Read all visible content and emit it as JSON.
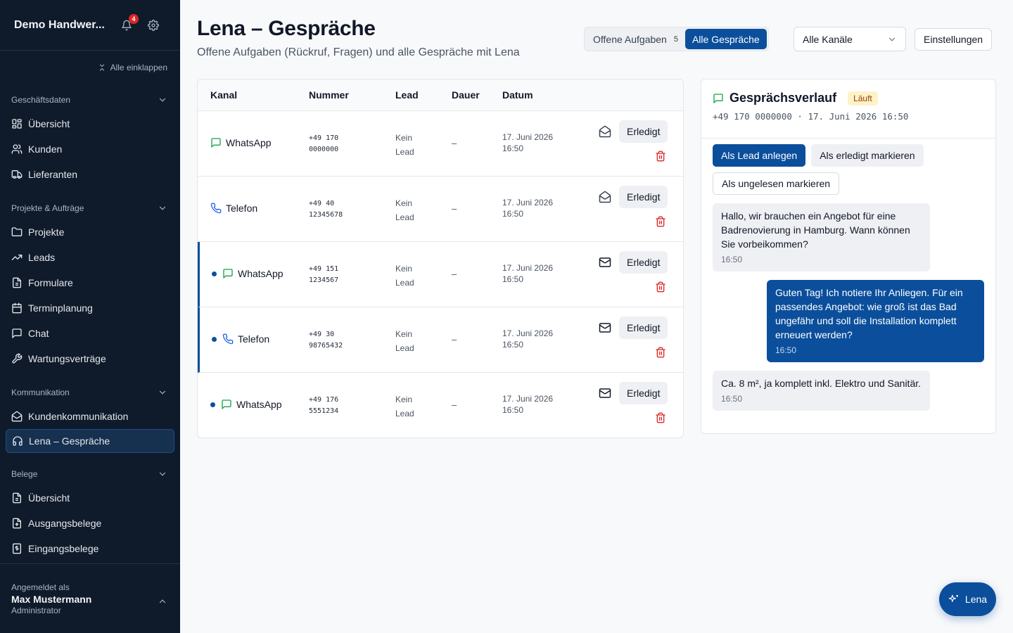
{
  "sidebar": {
    "title": "Demo Handwer...",
    "notification_count": "4",
    "collapse_all": "Alle einklappen",
    "sections": [
      {
        "title": "Geschäftsdaten",
        "items": [
          "Übersicht",
          "Kunden",
          "Lieferanten"
        ]
      },
      {
        "title": "Projekte & Aufträge",
        "items": [
          "Projekte",
          "Leads",
          "Formulare",
          "Terminplanung",
          "Chat",
          "Wartungsverträge"
        ]
      },
      {
        "title": "Kommunikation",
        "items": [
          "Kundenkommunikation",
          "Lena – Gespräche"
        ]
      },
      {
        "title": "Belege",
        "items": [
          "Übersicht",
          "Ausgangsbelege",
          "Eingangsbelege"
        ]
      }
    ],
    "active_item": "Lena – Gespräche",
    "footer": {
      "label": "Angemeldet als",
      "name": "Max Mustermann",
      "role": "Administrator"
    }
  },
  "header": {
    "title": "Lena – Gespräche",
    "subtitle": "Offene Aufgaben (Rückruf, Fragen) und alle Gespräche mit Lena",
    "toggle": {
      "open_label": "Offene Aufgaben",
      "open_count": "5",
      "all_label": "Alle Gespräche"
    },
    "channel_select": "Alle Kanäle",
    "settings": "Einstellungen"
  },
  "table": {
    "columns": [
      "Kanal",
      "Nummer",
      "Lead",
      "Dauer",
      "Datum"
    ],
    "rows": [
      {
        "channel": "WhatsApp",
        "channel_icon": "whatsapp-icon",
        "number_line1": "+49 170",
        "number_line2": "0000000",
        "lead_line1": "Kein",
        "lead_line2": "Lead",
        "duration": "–",
        "date_line1": "17. Juni 2026",
        "date_line2": "16:50",
        "done": "Erledigt",
        "unread": false,
        "mail_icon": "mail-open-icon"
      },
      {
        "channel": "Telefon",
        "channel_icon": "phone-icon",
        "number_line1": "+49 40",
        "number_line2": "12345678",
        "lead_line1": "Kein",
        "lead_line2": "Lead",
        "duration": "–",
        "date_line1": "17. Juni 2026",
        "date_line2": "16:50",
        "done": "Erledigt",
        "unread": false,
        "mail_icon": "mail-open-icon"
      },
      {
        "channel": "WhatsApp",
        "channel_icon": "whatsapp-icon",
        "number_line1": "+49 151",
        "number_line2": "1234567",
        "lead_line1": "Kein",
        "lead_line2": "Lead",
        "duration": "–",
        "date_line1": "17. Juni 2026",
        "date_line2": "16:50",
        "done": "Erledigt",
        "unread": true,
        "mail_icon": "mail-icon"
      },
      {
        "channel": "Telefon",
        "channel_icon": "phone-icon",
        "number_line1": "+49 30",
        "number_line2": "98765432",
        "lead_line1": "Kein",
        "lead_line2": "Lead",
        "duration": "–",
        "date_line1": "17. Juni 2026",
        "date_line2": "16:50",
        "done": "Erledigt",
        "unread": true,
        "mail_icon": "mail-icon"
      },
      {
        "channel": "WhatsApp",
        "channel_icon": "whatsapp-icon",
        "number_line1": "+49 176",
        "number_line2": "5551234",
        "lead_line1": "Kein",
        "lead_line2": "Lead",
        "duration": "–",
        "date_line1": "17. Juni 2026",
        "date_line2": "16:50",
        "done": "Erledigt",
        "unread": false,
        "dot": true,
        "mail_icon": "mail-icon"
      }
    ]
  },
  "conversation": {
    "title": "Gesprächsverlauf",
    "status": "Läuft",
    "meta": "+49 170 0000000 · 17. Juni 2026 16:50",
    "actions": {
      "create_lead": "Als Lead anlegen",
      "mark_done": "Als erledigt markieren",
      "mark_unread": "Als ungelesen markieren"
    },
    "messages": [
      {
        "direction": "in",
        "text": "Hallo, wir brauchen ein Angebot für eine Badrenovierung in Hamburg. Wann können Sie vorbeikommen?",
        "time": "16:50"
      },
      {
        "direction": "out",
        "text": "Guten Tag! Ich notiere Ihr Anliegen. Für ein passendes Angebot: wie groß ist das Bad ungefähr und soll die Installation komplett erneuert werden?",
        "time": "16:50"
      },
      {
        "direction": "in",
        "text": "Ca. 8 m², ja komplett inkl. Elektro und Sanitär.",
        "time": "16:50"
      }
    ]
  },
  "fab": {
    "label": "Lena"
  },
  "colors": {
    "sidebar_bg": "#0f1b2b",
    "accent": "#0b4f9c",
    "whatsapp": "#16a34a",
    "delete": "#dc2626",
    "status_bg": "#fef3c7"
  }
}
